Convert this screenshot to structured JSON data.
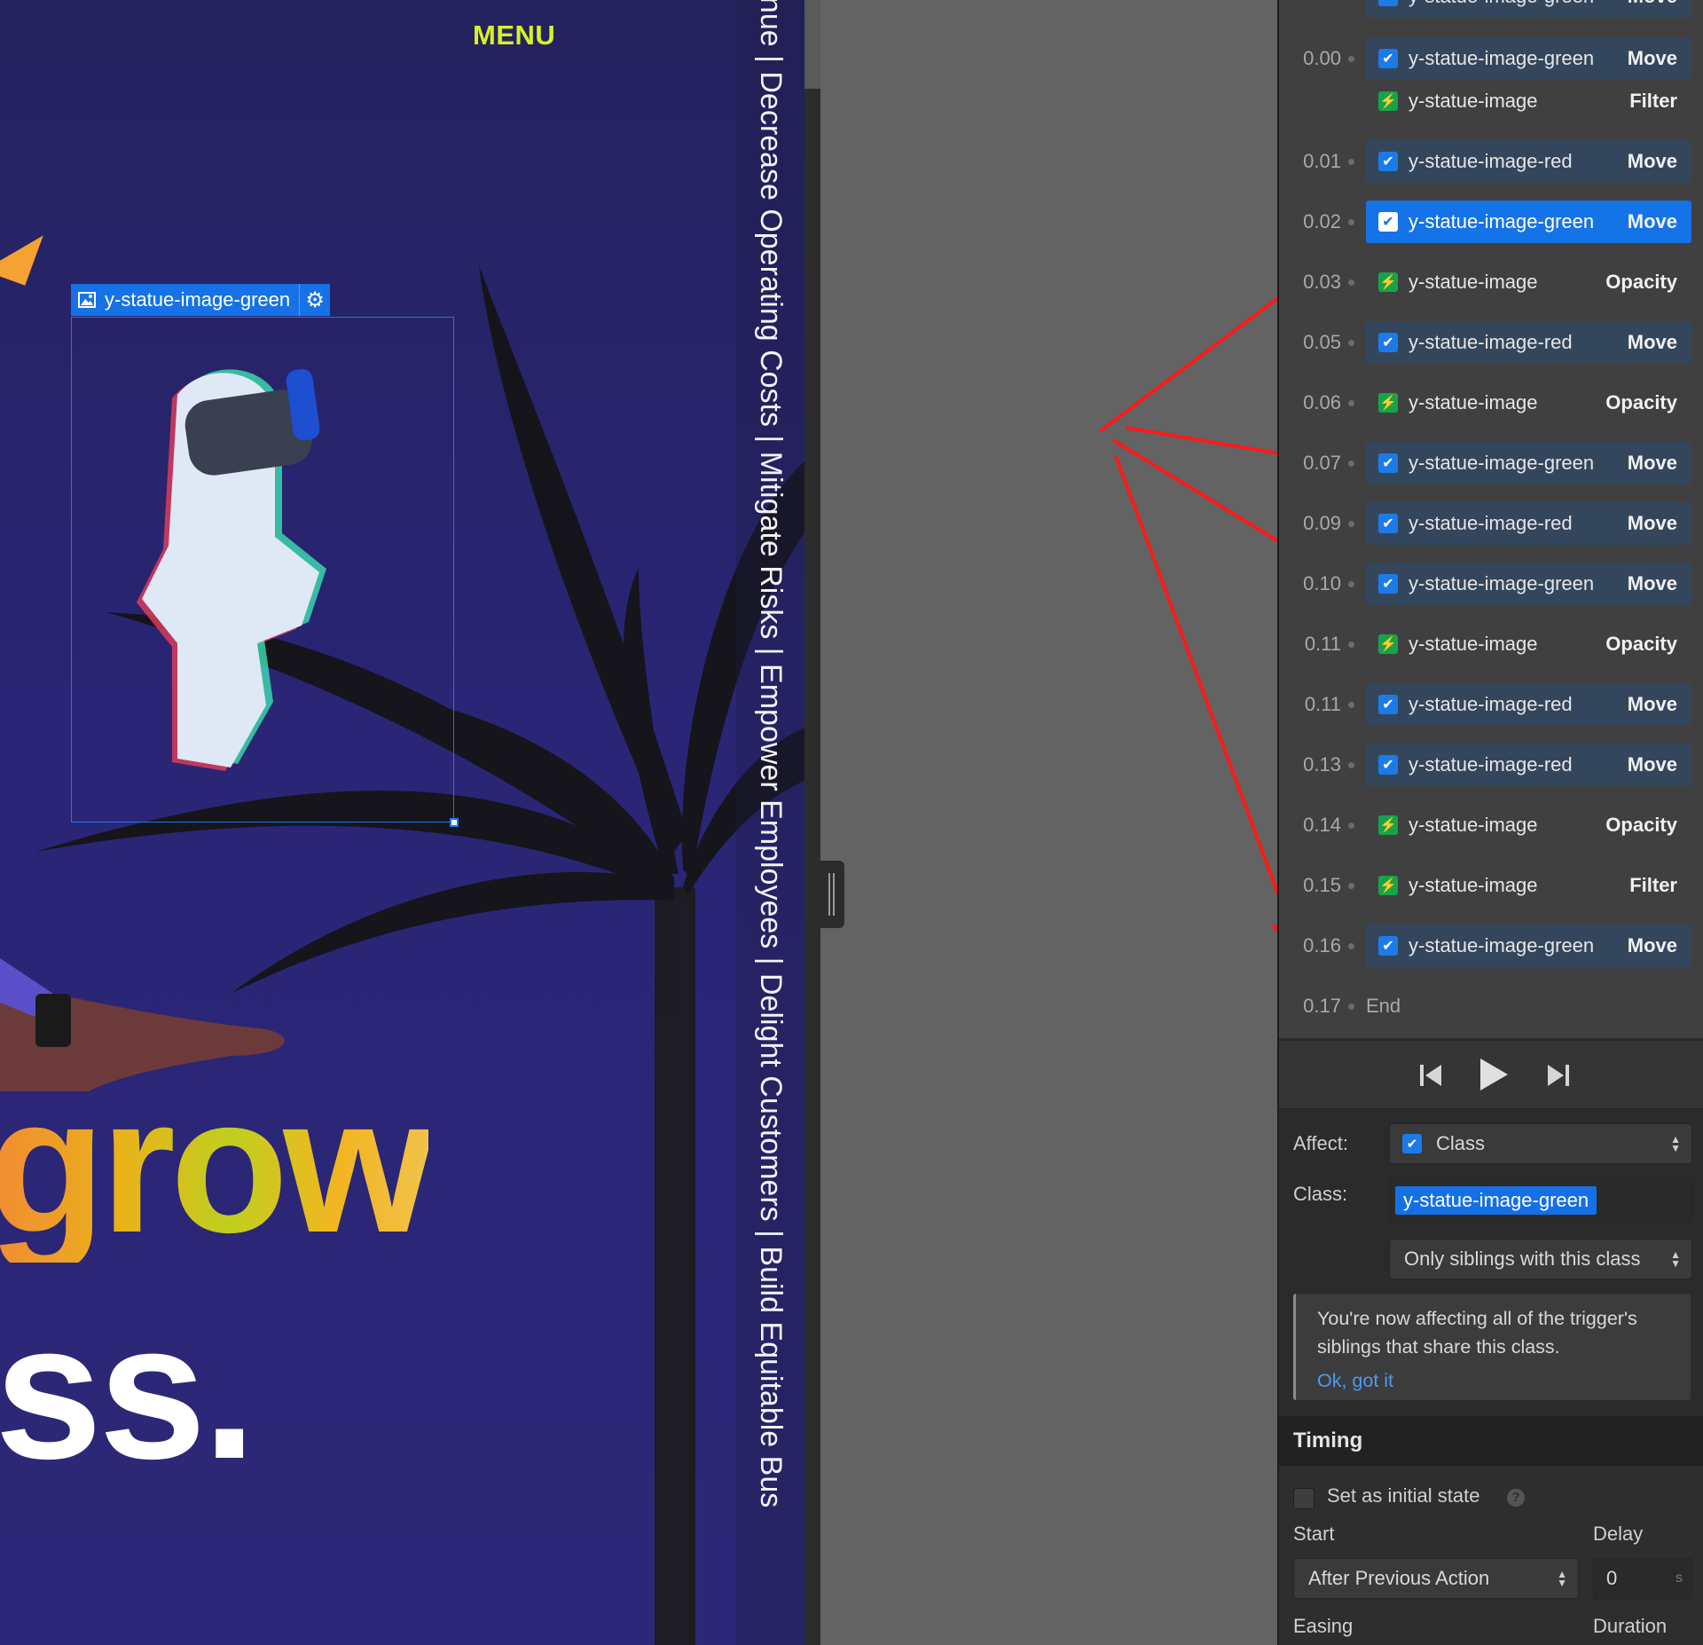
{
  "preview": {
    "menu_label": "MENU",
    "ticker_text": "venue  |  Decrease Operating Costs  |  Mitigate Risks  |  Empower Employees  |  Delight Customers  |  Build Equitable Bus",
    "headline_line1": "grow",
    "headline_line2": "ss.",
    "selection_label": "y-statue-image-green"
  },
  "timeline": {
    "partial_row": {
      "target": "y-statue-image-green",
      "action": "Move"
    },
    "rows": [
      {
        "time": "0.00",
        "steps": [
          {
            "icon": "brush-icon",
            "kind": "class",
            "target": "y-statue-image-green",
            "action": "Move"
          },
          {
            "icon": "bolt-icon",
            "kind": "element",
            "target": "y-statue-image",
            "action": "Filter"
          }
        ]
      },
      {
        "time": "0.01",
        "steps": [
          {
            "icon": "brush-icon",
            "kind": "class",
            "target": "y-statue-image-red",
            "action": "Move"
          }
        ]
      },
      {
        "time": "0.02",
        "steps": [
          {
            "icon": "brush-icon",
            "kind": "selected",
            "target": "y-statue-image-green",
            "action": "Move"
          }
        ]
      },
      {
        "time": "0.03",
        "steps": [
          {
            "icon": "bolt-icon",
            "kind": "element",
            "target": "y-statue-image",
            "action": "Opacity"
          }
        ]
      },
      {
        "time": "0.05",
        "steps": [
          {
            "icon": "brush-icon",
            "kind": "class",
            "target": "y-statue-image-red",
            "action": "Move"
          }
        ]
      },
      {
        "time": "0.06",
        "steps": [
          {
            "icon": "bolt-icon",
            "kind": "element",
            "target": "y-statue-image",
            "action": "Opacity"
          }
        ]
      },
      {
        "time": "0.07",
        "steps": [
          {
            "icon": "brush-icon",
            "kind": "class",
            "target": "y-statue-image-green",
            "action": "Move"
          }
        ]
      },
      {
        "time": "0.09",
        "steps": [
          {
            "icon": "brush-icon",
            "kind": "class",
            "target": "y-statue-image-red",
            "action": "Move"
          }
        ]
      },
      {
        "time": "0.10",
        "steps": [
          {
            "icon": "brush-icon",
            "kind": "class",
            "target": "y-statue-image-green",
            "action": "Move"
          }
        ]
      },
      {
        "time": "0.11",
        "steps": [
          {
            "icon": "bolt-icon",
            "kind": "element",
            "target": "y-statue-image",
            "action": "Opacity"
          }
        ]
      },
      {
        "time": "0.11",
        "steps": [
          {
            "icon": "brush-icon",
            "kind": "class",
            "target": "y-statue-image-red",
            "action": "Move"
          }
        ]
      },
      {
        "time": "0.13",
        "steps": [
          {
            "icon": "brush-icon",
            "kind": "class",
            "target": "y-statue-image-red",
            "action": "Move"
          }
        ]
      },
      {
        "time": "0.14",
        "steps": [
          {
            "icon": "bolt-icon",
            "kind": "element",
            "target": "y-statue-image",
            "action": "Opacity"
          }
        ]
      },
      {
        "time": "0.15",
        "steps": [
          {
            "icon": "bolt-icon",
            "kind": "element",
            "target": "y-statue-image",
            "action": "Filter"
          }
        ]
      },
      {
        "time": "0.16",
        "steps": [
          {
            "icon": "brush-icon",
            "kind": "class",
            "target": "y-statue-image-green",
            "action": "Move"
          }
        ]
      }
    ],
    "end_time": "0.17",
    "end_label": "End"
  },
  "playback": {
    "first": "skip-back-icon",
    "play": "play-icon",
    "last": "skip-forward-icon"
  },
  "affect": {
    "label": "Affect:",
    "value": "Class"
  },
  "class_field": {
    "label": "Class:",
    "value": "y-statue-image-green"
  },
  "scope": {
    "value": "Only siblings with this class"
  },
  "notice": {
    "text": "You're now affecting all of the trigger's siblings that share this class.",
    "link": "Ok, got it"
  },
  "timing": {
    "header": "Timing",
    "initial_state_label": "Set as initial state",
    "help": "?",
    "start_label": "Start",
    "start_value": "After Previous Action",
    "delay_label": "Delay",
    "delay_value": "0",
    "delay_unit": "s",
    "easing_label": "Easing",
    "duration_label": "Duration"
  },
  "colors": {
    "accent": "#1473e6",
    "menu": "#d7f224",
    "annotation_arrow": "#ff1a1a",
    "panel_bg": "#2b2b2b",
    "timeline_bg": "#404040",
    "canvas_bg": "#2a2575"
  }
}
